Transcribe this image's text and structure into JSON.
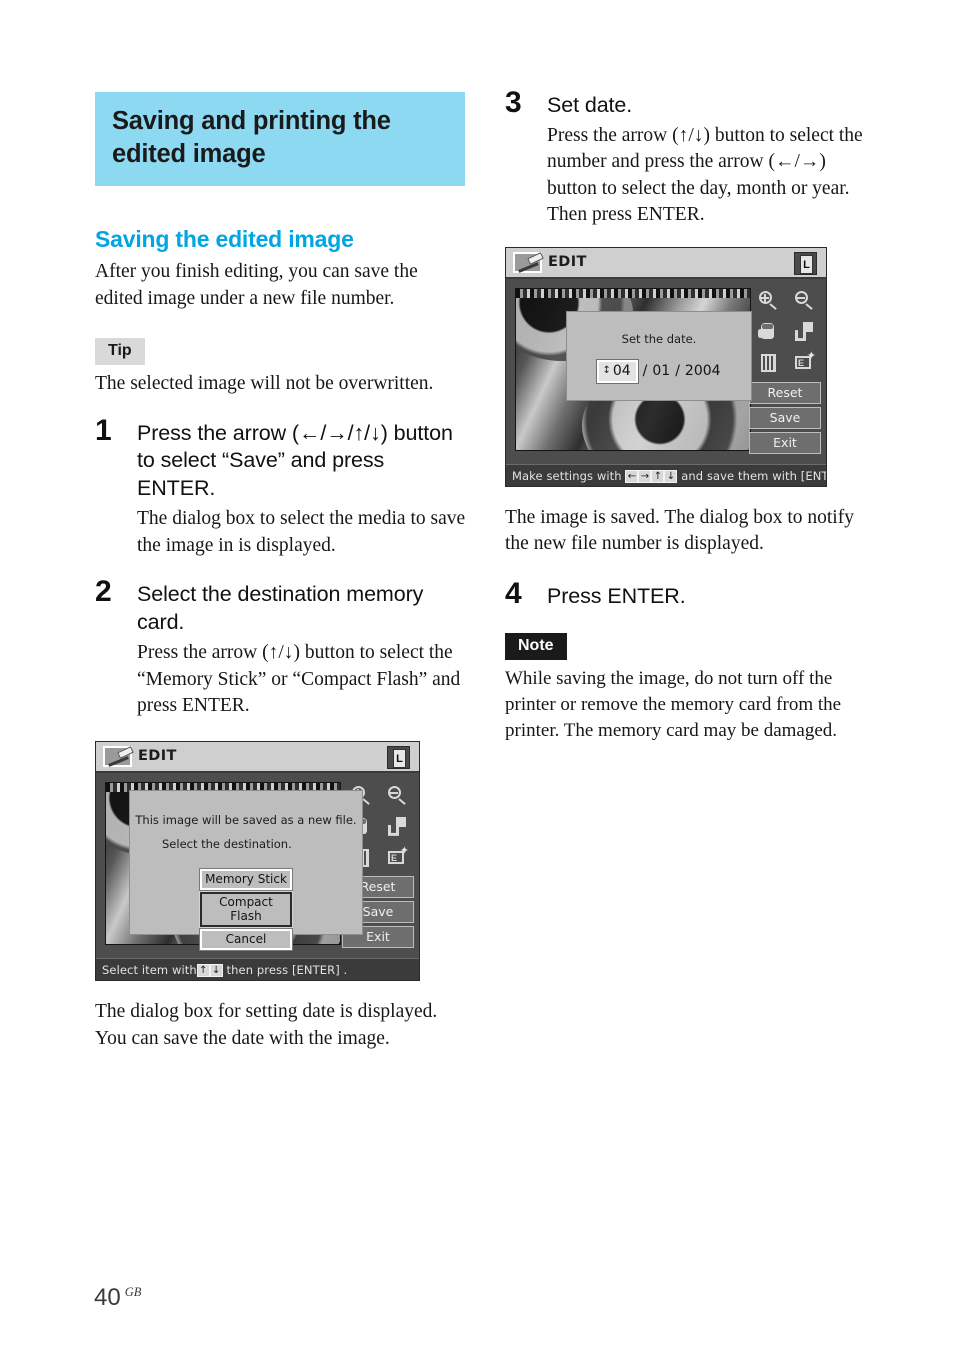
{
  "page": {
    "number": "40",
    "region_code": "GB"
  },
  "chapter": {
    "title": "Saving and printing the edited image",
    "bg_color": "#8ed9f2"
  },
  "section": {
    "title": "Saving the edited image",
    "color": "#00a6e2",
    "intro": "After you finish editing, you can save the edited image under a new file number."
  },
  "tip": {
    "label": "Tip",
    "text": "The selected image will not be overwritten."
  },
  "note": {
    "label": "Note",
    "text": "While saving the image, do not turn off the printer or remove the memory card from the printer.  The memory card may be damaged."
  },
  "steps": [
    {
      "num": "1",
      "title": "Press the arrow (←/→/↑/↓) button to select “Save” and press ENTER.",
      "body": "The dialog box to select the media to save the image in is displayed."
    },
    {
      "num": "2",
      "title": "Select the destination memory card.",
      "body": "Press the arrow (↑/↓) button to select the “Memory Stick” or “Compact Flash” and press ENTER."
    },
    {
      "num": "3",
      "title": "Set date.",
      "body": "Press the arrow (↑/↓) button to select the number and press the arrow (←/→) button to select the day, month or year.  Then press ENTER."
    },
    {
      "num": "4",
      "title": "Press ENTER.",
      "body": ""
    }
  ],
  "after_step2_caption": "The dialog box for setting date is displayed. You can save the date with the image.",
  "after_step3_caption": "The image is saved.  The dialog box to notify the new file number is displayed.",
  "lcd_destination": {
    "header_title": "EDIT",
    "book_badge": "L",
    "dialog": {
      "line1": "This image will be saved as a new file.",
      "line2": "Select the destination.",
      "buttons": [
        "Memory Stick",
        "Compact Flash",
        "Cancel"
      ],
      "selected_button": "Compact Flash"
    },
    "side_buttons": [
      "Reset",
      "Save",
      "Exit"
    ],
    "status_prefix": "Select item with",
    "status_keys": [
      "↑",
      "↓"
    ],
    "status_suffix": "then press [ENTER] ."
  },
  "lcd_setdate": {
    "header_title": "EDIT",
    "book_badge": "L",
    "dialog": {
      "prompt": "Set the date.",
      "day": "04",
      "month": "01",
      "year": "2004",
      "separator": "/"
    },
    "side_buttons": [
      "Reset",
      "Save",
      "Exit"
    ],
    "status_prefix": "Make settings with",
    "status_keys": [
      "←",
      "→",
      "↑",
      "↓"
    ],
    "status_suffix": "and save them with [ENTER] ."
  },
  "toolbar_icons": [
    "zoom-in-icon",
    "zoom-out-icon",
    "hand-pan-icon",
    "crop-icon",
    "adjust-sliders-icon",
    "effect-icon",
    "red-eye-icon",
    "text-tool-icon"
  ]
}
